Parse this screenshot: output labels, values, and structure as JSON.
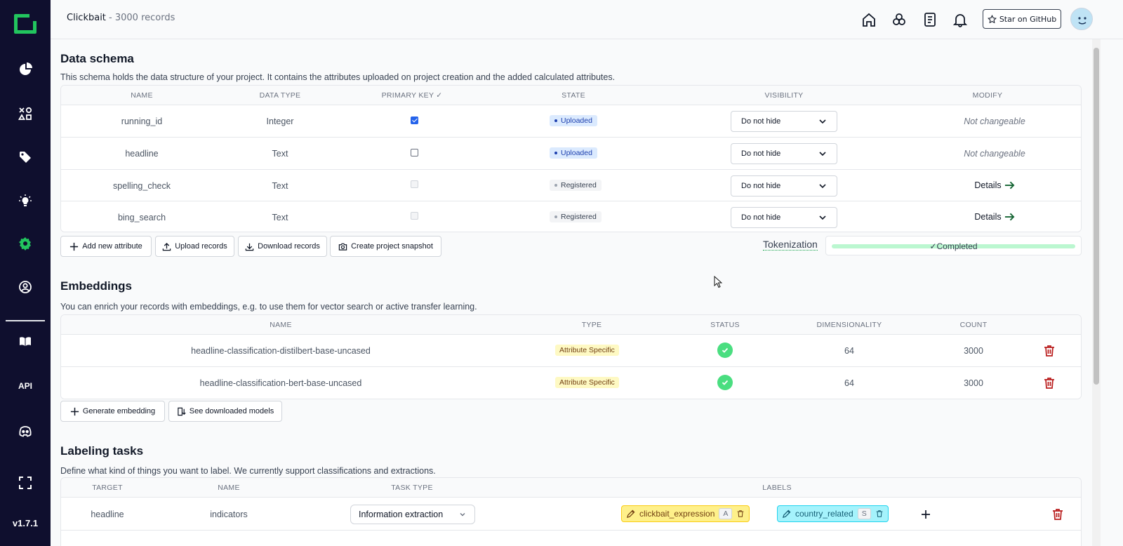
{
  "app": {
    "project_name": "Clickbait",
    "project_sub": "- 3000 records",
    "version": "v1.7.1",
    "star_label": "Star on GitHub"
  },
  "sidebar": {
    "items": [
      {
        "name": "overview",
        "icon": "pie-chart-icon"
      },
      {
        "name": "data-browser",
        "icon": "shapes-icon"
      },
      {
        "name": "labeling",
        "icon": "tag-icon"
      },
      {
        "name": "heuristics",
        "icon": "bulb-icon"
      },
      {
        "name": "settings",
        "icon": "gear-icon",
        "active": true
      },
      {
        "name": "admin",
        "icon": "user-circle-icon"
      },
      {
        "name": "docs",
        "icon": "book-icon"
      },
      {
        "name": "api",
        "label": "API"
      },
      {
        "name": "discord",
        "icon": "discord-icon"
      },
      {
        "name": "fullscreen",
        "icon": "fullscreen-icon"
      }
    ],
    "accent": "#22c55e"
  },
  "header": {
    "icons": [
      "home-icon",
      "circles-icon",
      "document-icon",
      "bell-icon"
    ]
  },
  "schema": {
    "title": "Data schema",
    "description": "This schema holds the data structure of your project. It contains the attributes uploaded on project creation and the added calculated attributes.",
    "columns": [
      "NAME",
      "DATA TYPE",
      "PRIMARY KEY",
      "STATE",
      "VISIBILITY",
      "MODIFY"
    ],
    "rows": [
      {
        "name": "running_id",
        "type": "Integer",
        "pk": true,
        "state": "Uploaded",
        "visibility": "Do not hide",
        "modify": "Not changeable"
      },
      {
        "name": "headline",
        "type": "Text",
        "pk": false,
        "state": "Uploaded",
        "visibility": "Do not hide",
        "modify": "Not changeable"
      },
      {
        "name": "spelling_check",
        "type": "Text",
        "pk": false,
        "state": "Registered",
        "visibility": "Do not hide",
        "modify": "Details"
      },
      {
        "name": "bing_search",
        "type": "Text",
        "pk": false,
        "state": "Registered",
        "visibility": "Do not hide",
        "modify": "Details"
      }
    ],
    "buttons": {
      "add_attribute": "Add new attribute",
      "upload_records": "Upload records",
      "download_records": "Download records",
      "create_snapshot": "Create project snapshot"
    },
    "tokenization": {
      "label": "Tokenization",
      "status": "Completed",
      "progress": 1.0
    }
  },
  "embeddings": {
    "title": "Embeddings",
    "description": "You can enrich your records with embeddings, e.g. to use them for vector search or active transfer learning.",
    "columns": [
      "NAME",
      "TYPE",
      "STATUS",
      "DIMENSIONALITY",
      "COUNT"
    ],
    "rows": [
      {
        "name": "headline-classification-distilbert-base-uncased",
        "type": "Attribute Specific",
        "status": "ok",
        "dim": "64",
        "count": "3000"
      },
      {
        "name": "headline-classification-bert-base-uncased",
        "type": "Attribute Specific",
        "status": "ok",
        "dim": "64",
        "count": "3000"
      }
    ],
    "buttons": {
      "generate": "Generate embedding",
      "models": "See downloaded models"
    }
  },
  "labeling": {
    "title": "Labeling tasks",
    "description": "Define what kind of things you want to label. We currently support classifications and extractions.",
    "columns": [
      "TARGET",
      "NAME",
      "TASK TYPE",
      "LABELS"
    ],
    "rows": [
      {
        "target": "headline",
        "name": "indicators",
        "task_type": "Information extraction",
        "labels": [
          {
            "name": "clickbait_expression",
            "key": "A",
            "color": "yellow"
          },
          {
            "name": "country_related",
            "key": "S",
            "color": "cyan"
          }
        ]
      }
    ]
  }
}
